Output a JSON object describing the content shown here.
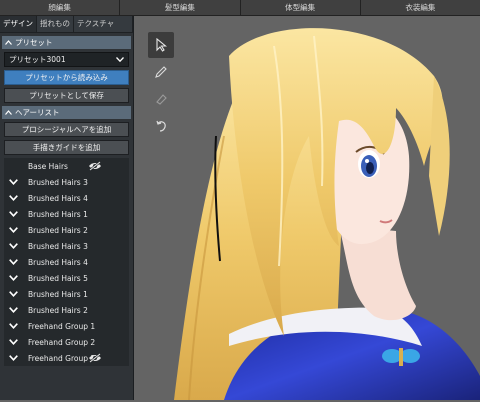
{
  "top_tabs": [
    "顔編集",
    "髪型編集",
    "体型編集",
    "衣装編集"
  ],
  "sub_tabs": [
    "デザイン",
    "揺れもの",
    "テクスチャ"
  ],
  "preset_section": {
    "title": "プリセット",
    "selected_preset": "プリセット3001",
    "load_button": "プリセットから読み込み",
    "save_button": "プリセットとして保存"
  },
  "hair_section": {
    "title": "ヘアーリスト",
    "add_procedural_button": "プロシージャルヘアを追加",
    "add_guide_button": "手描きガイドを追加",
    "items": [
      {
        "label": "Base Hairs",
        "chevron": false,
        "hidden": true
      },
      {
        "label": "Brushed Hairs 3",
        "chevron": true,
        "hidden": false
      },
      {
        "label": "Brushed Hairs 4",
        "chevron": true,
        "hidden": false
      },
      {
        "label": "Brushed Hairs 1",
        "chevron": true,
        "hidden": false
      },
      {
        "label": "Brushed Hairs 2",
        "chevron": true,
        "hidden": false
      },
      {
        "label": "Brushed Hairs 3",
        "chevron": true,
        "hidden": false
      },
      {
        "label": "Brushed Hairs 4",
        "chevron": true,
        "hidden": false
      },
      {
        "label": "Brushed Hairs 5",
        "chevron": true,
        "hidden": false
      },
      {
        "label": "Brushed Hairs 1",
        "chevron": true,
        "hidden": false
      },
      {
        "label": "Brushed Hairs 2",
        "chevron": true,
        "hidden": false
      },
      {
        "label": "Freehand Group 1",
        "chevron": true,
        "hidden": false
      },
      {
        "label": "Freehand Group 2",
        "chevron": true,
        "hidden": false
      },
      {
        "label": "Freehand Group 3",
        "chevron": true,
        "hidden": true
      }
    ]
  },
  "tools": [
    "select-pointer-icon",
    "pen-icon",
    "eraser-icon",
    "rotate-icon"
  ],
  "colors": {
    "accent_blue": "#3f7fbf",
    "section_header": "#5b6b7a",
    "panel_bg": "#2f3337",
    "viewport_bg": "#646464",
    "hair": "#f3d27a"
  }
}
